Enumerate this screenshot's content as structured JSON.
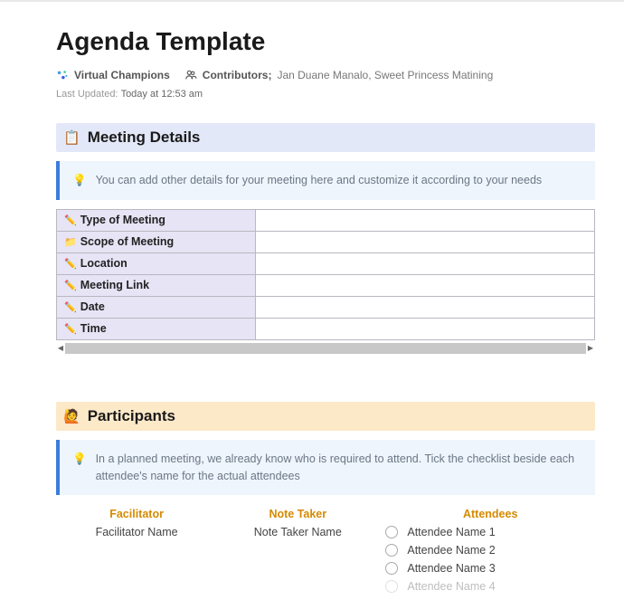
{
  "title": "Agenda Template",
  "workspace": {
    "name": "Virtual Champions"
  },
  "contributors": {
    "label": "Contributors;",
    "names": "Jan Duane Manalo, Sweet Princess Matining"
  },
  "updated": {
    "label": "Last Updated:",
    "time": "Today at 12:53 am"
  },
  "sections": {
    "meeting_details": {
      "title": "Meeting Details",
      "callout": "You can add other details for your meeting here and customize it according to your needs",
      "rows": [
        {
          "icon": "pencil",
          "label": "Type of Meeting",
          "value": ""
        },
        {
          "icon": "folder",
          "label": "Scope of Meeting",
          "value": ""
        },
        {
          "icon": "pencil",
          "label": "Location",
          "value": ""
        },
        {
          "icon": "pencil",
          "label": "Meeting Link",
          "value": ""
        },
        {
          "icon": "pencil",
          "label": "Date",
          "value": ""
        },
        {
          "icon": "pencil",
          "label": "Time",
          "value": ""
        }
      ]
    },
    "participants": {
      "title": "Participants",
      "callout": "In a planned meeting, we already know who is required to attend. Tick the checklist beside each attendee's name for the actual attendees",
      "facilitator": {
        "header": "Facilitator",
        "name": "Facilitator Name"
      },
      "note_taker": {
        "header": "Note Taker",
        "name": "Note Taker Name"
      },
      "attendees": {
        "header": "Attendees",
        "list": [
          "Attendee Name 1",
          "Attendee Name 2",
          "Attendee Name 3",
          "Attendee Name 4"
        ]
      }
    }
  }
}
